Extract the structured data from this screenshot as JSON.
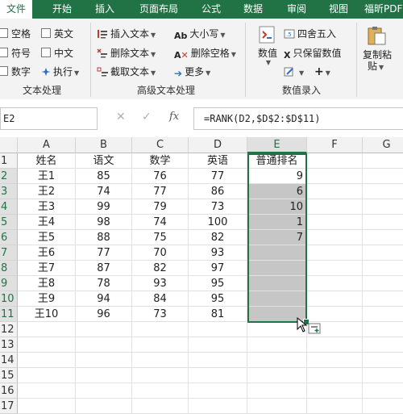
{
  "ribbon_tabs": [
    "文件",
    "开始",
    "插入",
    "页面布局",
    "公式",
    "数据",
    "审阅",
    "视图",
    "福昕PDF"
  ],
  "ribbon": {
    "group1": {
      "items": [
        "空格",
        "符号",
        "数字",
        "英文",
        "中文",
        "执行"
      ],
      "label": "文本处理"
    },
    "group2": {
      "items": [
        "插入文本",
        "删除文本",
        "截取文本",
        "大小写",
        "删除空格",
        "更多"
      ],
      "label": "高级文本处理"
    },
    "group3": {
      "items": [
        "数值",
        "四舍五入",
        "只保留数值"
      ],
      "label": "数值录入"
    },
    "group4": {
      "items": [
        "复制粘",
        "贴"
      ]
    }
  },
  "formula_bar": {
    "name_box": "E2",
    "cancel": "✕",
    "enter": "✓",
    "fx": "fx",
    "formula": "=RANK(D2,$D$2:$D$11)"
  },
  "columns": [
    "A",
    "B",
    "C",
    "D",
    "E",
    "F",
    "G"
  ],
  "rows": [
    "1",
    "2",
    "3",
    "4",
    "5",
    "6",
    "7",
    "8",
    "9",
    "10",
    "11",
    "12",
    "13",
    "14",
    "15",
    "16",
    "17"
  ],
  "sheet": {
    "header": [
      "姓名",
      "语文",
      "数学",
      "英语",
      "普通排名"
    ],
    "data": [
      [
        "王1",
        "85",
        "76",
        "77",
        "9"
      ],
      [
        "王2",
        "74",
        "77",
        "86",
        "6"
      ],
      [
        "王3",
        "99",
        "79",
        "73",
        "10"
      ],
      [
        "王4",
        "98",
        "74",
        "100",
        "1"
      ],
      [
        "王5",
        "88",
        "75",
        "82",
        "7"
      ],
      [
        "王6",
        "77",
        "70",
        "93",
        ""
      ],
      [
        "王7",
        "87",
        "82",
        "97",
        ""
      ],
      [
        "王8",
        "78",
        "93",
        "95",
        ""
      ],
      [
        "王9",
        "94",
        "84",
        "95",
        ""
      ],
      [
        "王10",
        "96",
        "73",
        "81",
        ""
      ]
    ]
  },
  "colors": {
    "accent": "#217346",
    "selection_fill": "#c6c6c6"
  }
}
